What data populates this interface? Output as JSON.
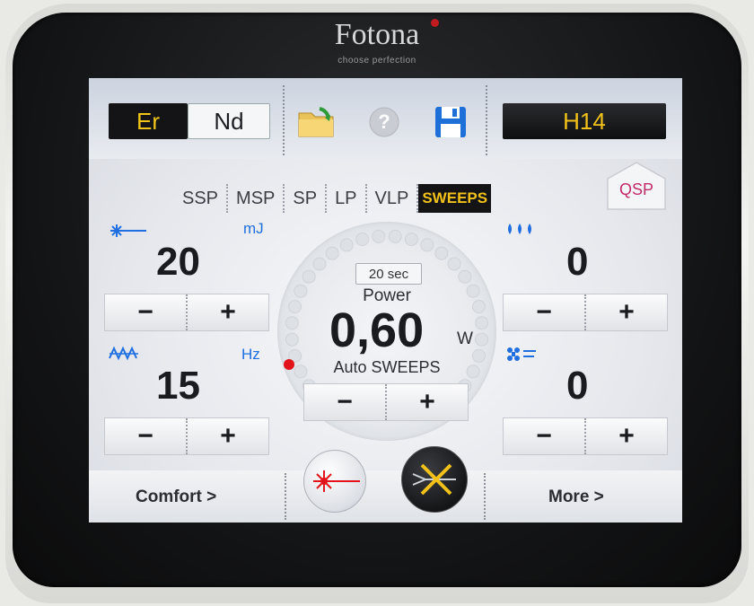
{
  "device": {
    "brand": "Fotona",
    "tagline": "choose perfection"
  },
  "laser_select": {
    "er_label": "Er",
    "nd_label": "Nd"
  },
  "toolbar": {
    "folder_icon": "folder-icon",
    "help_icon": "help-icon",
    "save_icon": "save-icon"
  },
  "handpiece": {
    "label": "H14"
  },
  "modes": {
    "items": [
      "SSP",
      "MSP",
      "SP",
      "LP",
      "VLP",
      "SWEEPS"
    ],
    "active": "SWEEPS",
    "qsp_label": "QSP"
  },
  "energy": {
    "unit": "mJ",
    "value": "20",
    "icon": "energy-icon"
  },
  "frequency": {
    "unit": "Hz",
    "value": "15",
    "icon": "frequency-icon"
  },
  "water": {
    "value": "0",
    "icon": "water-drops-icon"
  },
  "air": {
    "value": "0",
    "icon": "air-spray-icon"
  },
  "power": {
    "timer": "20 sec",
    "label": "Power",
    "value": "0,60",
    "unit": "W",
    "mode_label": "Auto SWEEPS"
  },
  "buttons": {
    "minus": "−",
    "plus": "+"
  },
  "bottom": {
    "comfort_label": "Comfort >",
    "more_label": "More >"
  },
  "colors": {
    "accent_yellow": "#f2c21b",
    "accent_blue": "#1f6fe0",
    "qsp_pink": "#c22a6a",
    "laser_red": "#e0141a"
  }
}
